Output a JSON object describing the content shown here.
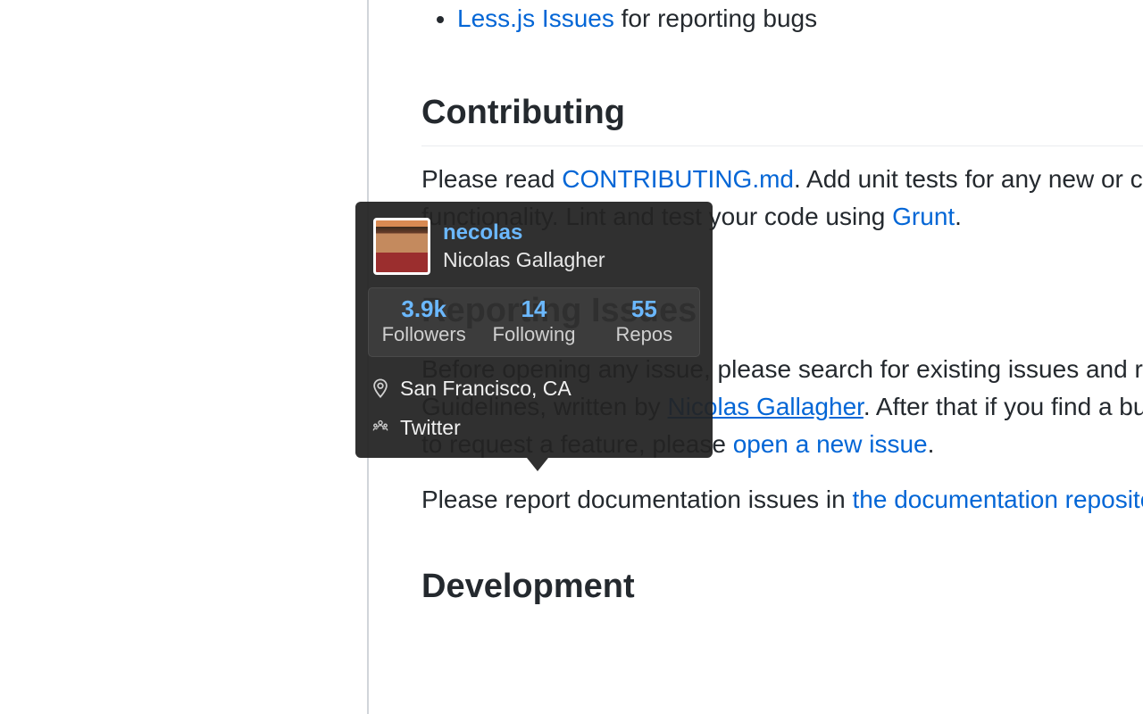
{
  "content": {
    "bullet_link": "Less.js Issues",
    "bullet_text_after": " for reporting bugs",
    "heading_contributing": "Contributing",
    "para_contributing_part1": "Please read ",
    "para_contributing_link": "CONTRIBUTING.md",
    "para_contributing_part2": ". Add unit tests for any new or changed functionality. Lint and test your code using ",
    "para_contributing_grunt": "Grunt",
    "para_contributing_end": ".",
    "heading_reporting": "Reporting Issues",
    "para_reporting_part1": "Before opening any issue, please search for existing issues and read the Issue Guidelines, written by ",
    "para_reporting_author": "Nicolas Gallagher",
    "para_reporting_part2": ". After that if you find a bug or would like to request a feature, please ",
    "para_reporting_link": "open a new issue",
    "para_reporting_end": ".",
    "para_doc_part1": "Please report documentation issues in ",
    "para_doc_link": "the documentation repository",
    "heading_development": "Development"
  },
  "hovercard": {
    "username": "necolas",
    "fullname": "Nicolas Gallagher",
    "stats": {
      "followers": {
        "value": "3.9k",
        "label": "Followers"
      },
      "following": {
        "value": "14",
        "label": "Following"
      },
      "repos": {
        "value": "55",
        "label": "Repos"
      }
    },
    "location": "San Francisco, CA",
    "company": "Twitter"
  }
}
